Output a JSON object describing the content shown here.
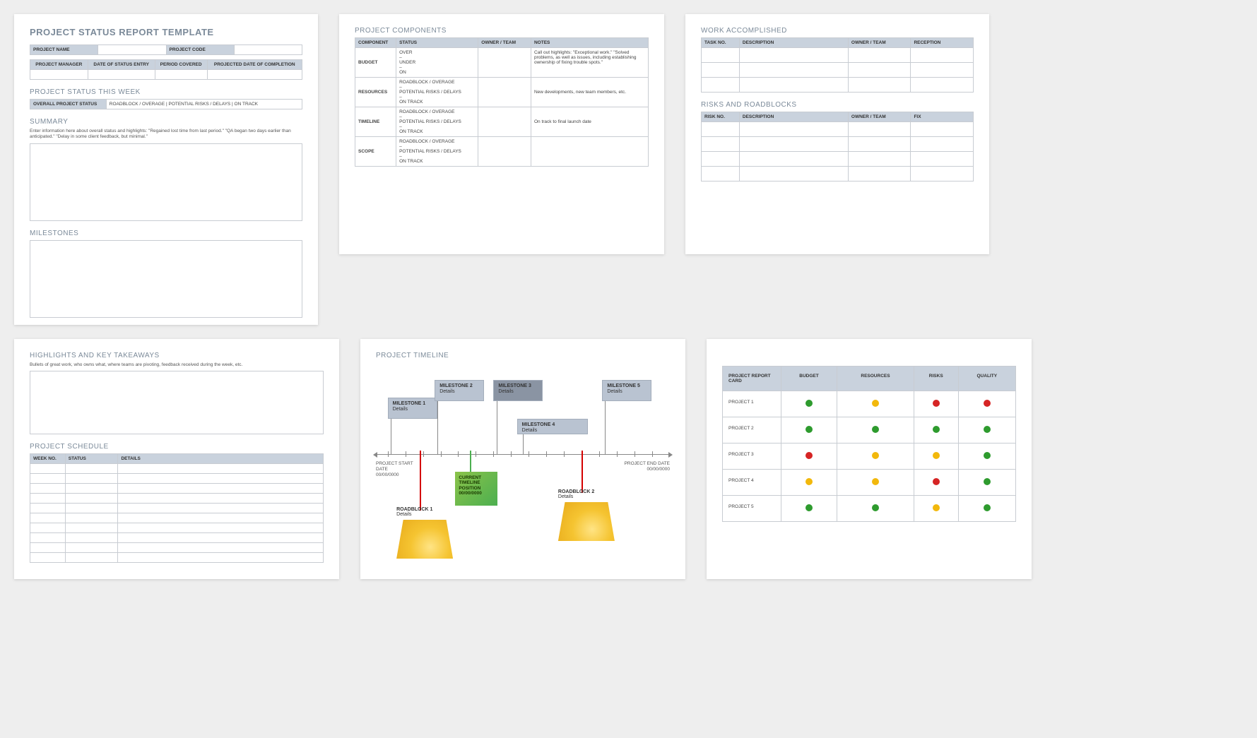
{
  "page1": {
    "title": "PROJECT STATUS REPORT TEMPLATE",
    "info_table": {
      "project_name": "PROJECT NAME",
      "project_code": "PROJECT CODE",
      "cols": [
        "PROJECT MANAGER",
        "DATE OF STATUS ENTRY",
        "PERIOD COVERED",
        "PROJECTED DATE OF COMPLETION"
      ]
    },
    "status_week_heading": "PROJECT STATUS THIS WEEK",
    "status_row": {
      "label": "OVERALL PROJECT STATUS",
      "text": "ROADBLOCK / OVERAGE   |   POTENTIAL RISKS / DELAYS   |   ON TRACK"
    },
    "summary_heading": "SUMMARY",
    "summary_hint": "Enter information here about overall status and highlights: \"Regained lost time from last period.\" \"QA began two days earlier than anticipated.\" \"Delay in some client feedback, but minimal.\"",
    "milestones_heading": "MILESTONES"
  },
  "page2": {
    "title": "PROJECT COMPONENTS",
    "headers": [
      "COMPONENT",
      "STATUS",
      "OWNER / TEAM",
      "NOTES"
    ],
    "rows": [
      {
        "comp": "BUDGET",
        "status": "OVER\n–\nUNDER\n–\nON",
        "notes": "Call out highlights: \"Exceptional work.\" \"Solved problems, as well as issues, including establishing ownership of fixing trouble spots.\""
      },
      {
        "comp": "RESOURCES",
        "status": "ROADBLOCK / OVERAGE\n–\nPOTENTIAL RISKS / DELAYS\n–\nON TRACK",
        "notes": "New developments, new team members, etc."
      },
      {
        "comp": "TIMELINE",
        "status": "ROADBLOCK / OVERAGE\n–\nPOTENTIAL RISKS / DELAYS\n–\nON TRACK",
        "notes": "On track to final launch date"
      },
      {
        "comp": "SCOPE",
        "status": "ROADBLOCK / OVERAGE\n–\nPOTENTIAL RISKS / DELAYS\n–\nON TRACK",
        "notes": ""
      }
    ]
  },
  "page3": {
    "work_title": "WORK ACCOMPLISHED",
    "work_headers": [
      "TASK NO.",
      "DESCRIPTION",
      "OWNER / TEAM",
      "RECEPTION"
    ],
    "risks_title": "RISKS AND ROADBLOCKS",
    "risks_headers": [
      "RISK NO.",
      "DESCRIPTION",
      "OWNER / TEAM",
      "FIX"
    ]
  },
  "page4": {
    "highlights_title": "HIGHLIGHTS AND KEY TAKEAWAYS",
    "highlights_hint": "Bullets of great work, who owns what, where teams are pivoting, feedback received during the week, etc.",
    "schedule_title": "PROJECT SCHEDULE",
    "schedule_headers": [
      "WEEK NO.",
      "STATUS",
      "DETAILS"
    ]
  },
  "page5": {
    "title": "PROJECT TIMELINE",
    "milestones": [
      {
        "name": "MILESTONE 1",
        "detail": "Details"
      },
      {
        "name": "MILESTONE 2",
        "detail": "Details"
      },
      {
        "name": "MILESTONE 3",
        "detail": "Details"
      },
      {
        "name": "MILESTONE 4",
        "detail": "Details"
      },
      {
        "name": "MILESTONE 5",
        "detail": "Details"
      }
    ],
    "start": {
      "label": "PROJECT START DATE",
      "date": "00/00/0000"
    },
    "end": {
      "label": "PROJECT END DATE",
      "date": "00/00/0000"
    },
    "current": "CURRENT TIMELINE POSITION 00/00/0000",
    "roadblocks": [
      {
        "name": "ROADBLOCK 1",
        "detail": "Details"
      },
      {
        "name": "ROADBLOCK 2",
        "detail": "Details"
      }
    ]
  },
  "page6": {
    "header_label": "PROJECT REPORT CARD",
    "cols": [
      "BUDGET",
      "RESOURCES",
      "RISKS",
      "QUALITY"
    ],
    "rows": [
      {
        "name": "PROJECT 1",
        "cells": [
          "g",
          "y",
          "r",
          "r"
        ]
      },
      {
        "name": "PROJECT 2",
        "cells": [
          "g",
          "g",
          "g",
          "g"
        ]
      },
      {
        "name": "PROJECT 3",
        "cells": [
          "r",
          "y",
          "y",
          "g"
        ]
      },
      {
        "name": "PROJECT 4",
        "cells": [
          "y",
          "y",
          "r",
          "g"
        ]
      },
      {
        "name": "PROJECT 5",
        "cells": [
          "g",
          "g",
          "y",
          "g"
        ]
      }
    ]
  }
}
